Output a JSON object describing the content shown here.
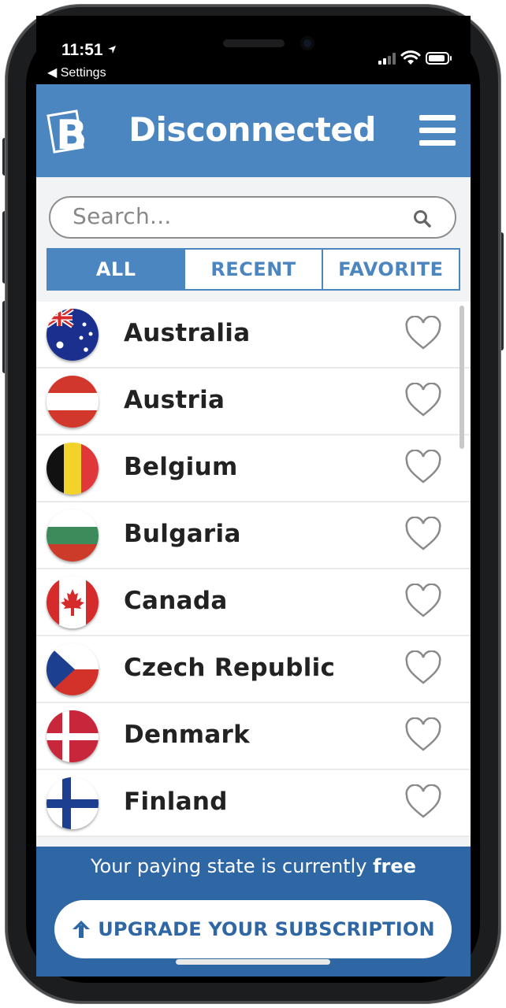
{
  "status_bar": {
    "time": "11:51",
    "back_label": "◀ Settings"
  },
  "header": {
    "title": "Disconnected",
    "logo_letter": "B",
    "menu_icon": "hamburger-menu-icon"
  },
  "search": {
    "placeholder": "Search...",
    "icon": "search-icon"
  },
  "tabs": [
    {
      "label": "ALL",
      "active": true
    },
    {
      "label": "RECENT",
      "active": false
    },
    {
      "label": "FAVORITE",
      "active": false
    }
  ],
  "countries": [
    {
      "name": "Australia",
      "flag": "australia-flag-icon",
      "favorite": false
    },
    {
      "name": "Austria",
      "flag": "austria-flag-icon",
      "favorite": false
    },
    {
      "name": "Belgium",
      "flag": "belgium-flag-icon",
      "favorite": false
    },
    {
      "name": "Bulgaria",
      "flag": "bulgaria-flag-icon",
      "favorite": false
    },
    {
      "name": "Canada",
      "flag": "canada-flag-icon",
      "favorite": false
    },
    {
      "name": "Czech Republic",
      "flag": "czech-republic-flag-icon",
      "favorite": false
    },
    {
      "name": "Denmark",
      "flag": "denmark-flag-icon",
      "favorite": false
    },
    {
      "name": "Finland",
      "flag": "finland-flag-icon",
      "favorite": false
    }
  ],
  "footer": {
    "paying_prefix": "Your paying state is currently ",
    "paying_state": "free",
    "upgrade_label": "UPGRADE YOUR SUBSCRIPTION"
  },
  "colors": {
    "brand_blue": "#4c86c0",
    "footer_blue": "#2f66a4"
  }
}
